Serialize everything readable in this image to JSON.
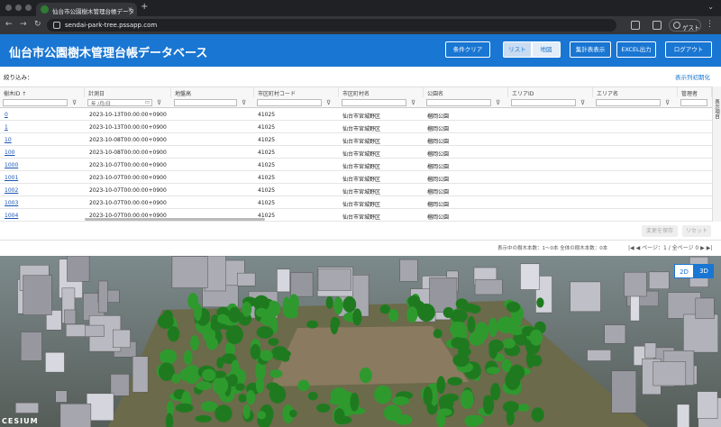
{
  "browser": {
    "tab_title": "仙台市公園樹木管理台帳データ",
    "new_tab": "+",
    "url": "sendai-park-tree.pssapp.com",
    "guest": "ゲスト"
  },
  "header": {
    "title": "仙台市公園樹木管理台帳データベース",
    "buttons": {
      "clear": "条件クリア",
      "list": "リスト",
      "map": "地図",
      "summary": "集計表表示",
      "excel": "EXCEL出力",
      "logout": "ログアウト"
    }
  },
  "filter": {
    "label": "絞り込み：",
    "reset_columns": "表示列初期化",
    "date_placeholder": "年 /月/日"
  },
  "table": {
    "columns": [
      "樹木ID ↑",
      "計測日",
      "地盤高",
      "市区町村コード",
      "市区町村名",
      "公園名",
      "エリアID",
      "エリア名",
      "管理者"
    ],
    "rows": [
      {
        "id": "0",
        "date": "2023-10-13T00:00:00+0900",
        "code": "41025",
        "city": "仙台市宮城野区",
        "park": "榴岡公園"
      },
      {
        "id": "1",
        "date": "2023-10-13T00:00:00+0900",
        "code": "41025",
        "city": "仙台市宮城野区",
        "park": "榴岡公園"
      },
      {
        "id": "10",
        "date": "2023-10-08T00:00:00+0900",
        "code": "41025",
        "city": "仙台市宮城野区",
        "park": "榴岡公園"
      },
      {
        "id": "100",
        "date": "2023-10-08T00:00:00+0900",
        "code": "41025",
        "city": "仙台市宮城野区",
        "park": "榴岡公園"
      },
      {
        "id": "1000",
        "date": "2023-10-07T00:00:00+0900",
        "code": "41025",
        "city": "仙台市宮城野区",
        "park": "榴岡公園"
      },
      {
        "id": "1001",
        "date": "2023-10-07T00:00:00+0900",
        "code": "41025",
        "city": "仙台市宮城野区",
        "park": "榴岡公園"
      },
      {
        "id": "1002",
        "date": "2023-10-07T00:00:00+0900",
        "code": "41025",
        "city": "仙台市宮城野区",
        "park": "榴岡公園"
      },
      {
        "id": "1003",
        "date": "2023-10-07T00:00:00+0900",
        "code": "41025",
        "city": "仙台市宮城野区",
        "park": "榴岡公園"
      },
      {
        "id": "1004",
        "date": "2023-10-07T00:00:00+0900",
        "code": "41025",
        "city": "仙台市宮城野区",
        "park": "榴岡公園"
      }
    ],
    "side_tab": "表示項目"
  },
  "actions": {
    "save": "変更を保存",
    "reset": "リセット"
  },
  "status": {
    "count": "表示中の樹木本数：1～0本 全体の樹木本数：0本",
    "page": "ページ：1 / 全ページ 0"
  },
  "map": {
    "mode_2d": "2D",
    "mode_3d": "3D",
    "logo": "CESIUM",
    "colors": {
      "accent": "#1976d2",
      "tree": "#1f7a1f"
    }
  }
}
